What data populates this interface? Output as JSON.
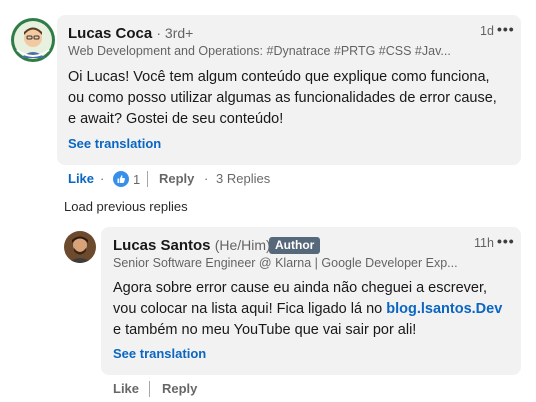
{
  "comment": {
    "author_name": "Lucas Coca",
    "degree": "· 3rd+",
    "headline": "Web Development and Operations: #Dynatrace #PRTG #CSS #Jav...",
    "time": "1d",
    "more_icon": "ellipsis-icon",
    "text": "Oi Lucas! Você tem algum conteúdo que explique como funciona, ou como posso utilizar algumas as funcionalidades de error cause, e await? Gostei de seu conteúdo!",
    "see_translation": "See translation",
    "like_label": "Like",
    "dot": "·",
    "reaction_icon": "thumbs-up-icon",
    "reaction_count": "1",
    "reply_label": "Reply",
    "replies_count": "3 Replies"
  },
  "load_previous": "Load previous replies",
  "reply": {
    "author_name": "Lucas Santos",
    "pronouns": "(He/Him)",
    "badge": "Author",
    "headline": "Senior Software Engineer @ Klarna | Google Developer Exp...",
    "time": "11h",
    "more_icon": "ellipsis-icon",
    "text_before": "Agora sobre error cause eu ainda não cheguei a escrever, vou colocar na lista aqui! Fica ligado lá no ",
    "link_text": "blog.lsantos.Dev",
    "text_after": " e também no meu YouTube que vai sair por ali!",
    "see_translation": "See translation",
    "like_label": "Like",
    "reply_label": "Reply"
  },
  "colors": {
    "link_blue": "#0a66c2",
    "bubble_gray": "#f2f2f2",
    "badge_gray": "#56687a"
  }
}
